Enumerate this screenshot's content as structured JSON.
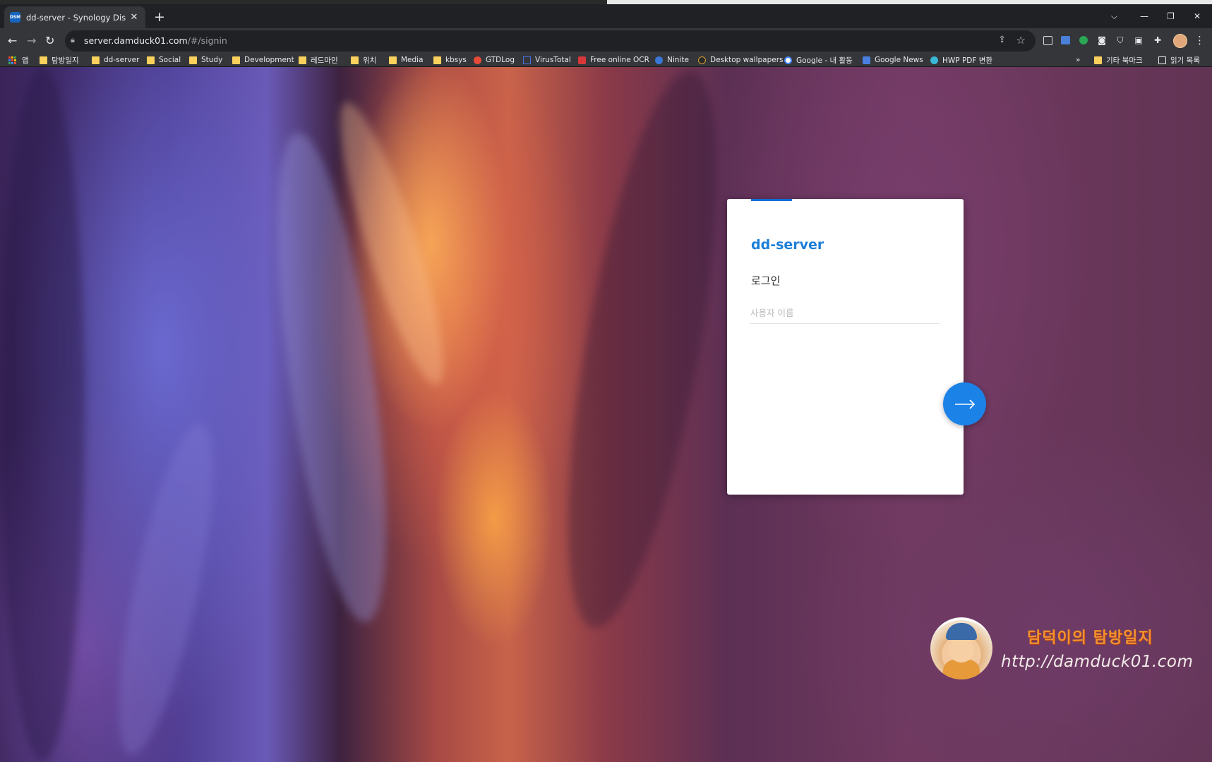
{
  "browser": {
    "tab_title": "dd-server - Synology DiskStatio",
    "tab_favicon_text": "DSM",
    "new_tab_symbol": "+",
    "tab_close_symbol": "✕",
    "url_host": "server.damduck01.com",
    "url_path": "/#/signin",
    "window_controls": {
      "dropdown": "⌵",
      "minimize": "—",
      "restore": "❐",
      "close": "✕"
    }
  },
  "bookmarks": {
    "apps_label": "앱",
    "items": [
      {
        "label": "탐방일지",
        "icon": "folder-icon"
      },
      {
        "label": "dd-server",
        "icon": "folder-icon"
      },
      {
        "label": "Social",
        "icon": "folder-icon"
      },
      {
        "label": "Study",
        "icon": "folder-icon"
      },
      {
        "label": "Development",
        "icon": "folder-icon"
      },
      {
        "label": "레드마인",
        "icon": "folder-icon"
      },
      {
        "label": "위치",
        "icon": "folder-icon"
      },
      {
        "label": "Media",
        "icon": "folder-icon"
      },
      {
        "label": "kbsys",
        "icon": "folder-icon"
      },
      {
        "label": "GTDLog",
        "icon": "gtdlog-icon"
      },
      {
        "label": "VirusTotal",
        "icon": "virustotal-icon"
      },
      {
        "label": "Free online OCR",
        "icon": "ocr-icon"
      },
      {
        "label": "Ninite",
        "icon": "ninite-icon"
      },
      {
        "label": "Desktop wallpapers",
        "icon": "wallpapers-icon"
      },
      {
        "label": "Google - 내 활동",
        "icon": "google-icon"
      },
      {
        "label": "Google News",
        "icon": "google-news-icon"
      },
      {
        "label": "HWP PDF 변환",
        "icon": "hwp-icon"
      }
    ],
    "overflow": "»",
    "other_bookmarks": "기타 북마크",
    "reading_list": "읽기 목록"
  },
  "colors": {
    "accent": "#1b82e8",
    "server_name": "#1a7ed8",
    "folder": "#f9d15c"
  },
  "login": {
    "server_name": "dd-server",
    "heading": "로그인",
    "username_placeholder": "사용자 이름",
    "username_value": ""
  },
  "watermark": {
    "name": "담덕이의 탐방일지",
    "url": "http://damduck01.com"
  }
}
